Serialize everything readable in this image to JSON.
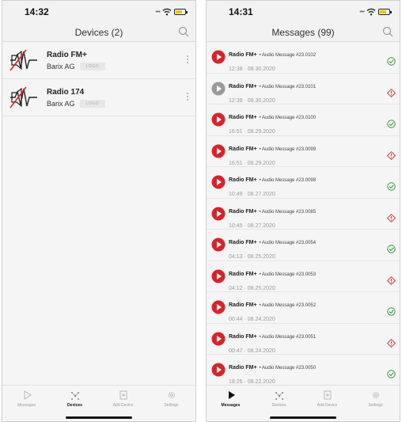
{
  "colors": {
    "accent_red": "#d8232a",
    "played_gray": "#9a9a9a",
    "ok_green": "#3a9a3a",
    "error_red": "#e03c3c"
  },
  "left": {
    "status_time": "14:32",
    "title": "Devices (2)",
    "devices": [
      {
        "name": "Radio FM+",
        "company": "Barix AG",
        "tag": "LOGO",
        "icon": "radio-offline-icon"
      },
      {
        "name": "Radio 174",
        "company": "Barix AG",
        "tag": "LOGO",
        "icon": "radio-offline-icon"
      }
    ],
    "tabs": [
      {
        "label": "Messages",
        "icon": "play-outline-icon",
        "active": false
      },
      {
        "label": "Devices",
        "icon": "devices-icon",
        "active": true
      },
      {
        "label": "Add Device",
        "icon": "add-device-icon",
        "active": false
      },
      {
        "label": "Settings",
        "icon": "gear-icon",
        "active": false
      }
    ]
  },
  "right": {
    "status_time": "14:31",
    "title": "Messages (99)",
    "messages": [
      {
        "sender": "Radio FM+",
        "title": "Audio Message #23.0102",
        "date": "12:38 · 08.30.2020",
        "played": false,
        "status": "ok"
      },
      {
        "sender": "Radio FM+",
        "title": "Audio Message #23.0101",
        "date": "12:39 · 08.30.2020",
        "played": true,
        "status": "error"
      },
      {
        "sender": "Radio FM+",
        "title": "Audio Message #23.0100",
        "date": "16:51 · 08.29.2020",
        "played": false,
        "status": "ok"
      },
      {
        "sender": "Radio FM+",
        "title": "Audio Message #23.0099",
        "date": "16:51 · 08.29.2020",
        "played": false,
        "status": "error"
      },
      {
        "sender": "Radio FM+",
        "title": "Audio Message #23.0098",
        "date": "10:49 · 08.27.2020",
        "played": false,
        "status": "ok"
      },
      {
        "sender": "Radio FM+",
        "title": "Audio Message #23.0085",
        "date": "10:45 · 08.27.2020",
        "played": false,
        "status": "error"
      },
      {
        "sender": "Radio FM+",
        "title": "Audio Message #23.0054",
        "date": "04:13 · 08.25.2020",
        "played": false,
        "status": "ok"
      },
      {
        "sender": "Radio FM+",
        "title": "Audio Message #23.0053",
        "date": "04:12 · 08.25.2020",
        "played": false,
        "status": "error"
      },
      {
        "sender": "Radio FM+",
        "title": "Audio Message #23.0052",
        "date": "00:44 · 08.24.2020",
        "played": false,
        "status": "ok"
      },
      {
        "sender": "Radio FM+",
        "title": "Audio Message #23.0051",
        "date": "00:47 · 08.24.2020",
        "played": false,
        "status": "error"
      },
      {
        "sender": "Radio FM+",
        "title": "Audio Message #23.0050",
        "date": "18:26 · 08.22.2020",
        "played": false,
        "status": "ok"
      }
    ],
    "tabs": [
      {
        "label": "Messages",
        "icon": "play-icon",
        "active": true
      },
      {
        "label": "Devices",
        "icon": "devices-icon",
        "active": false
      },
      {
        "label": "Add Device",
        "icon": "add-device-icon",
        "active": false
      },
      {
        "label": "Settings",
        "icon": "gear-icon",
        "active": false
      }
    ]
  }
}
